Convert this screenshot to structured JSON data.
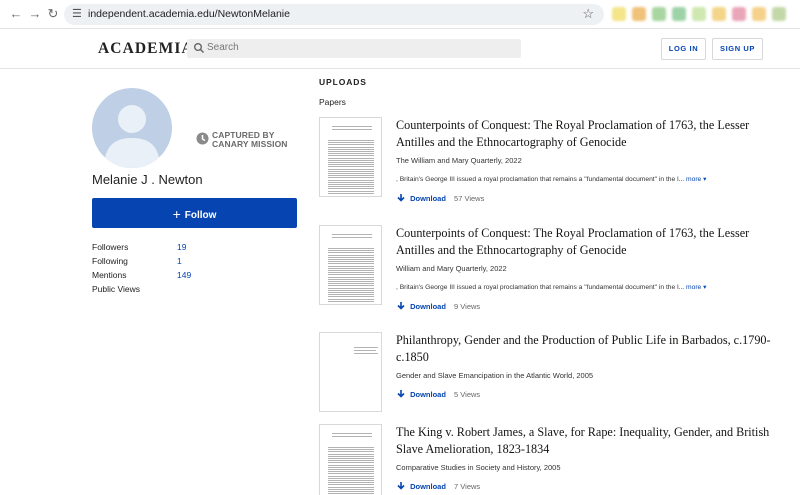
{
  "browser": {
    "url": "independent.academia.edu/NewtonMelanie",
    "colors": {
      "extensions": [
        "#f4e58a",
        "#f0c27a",
        "#a8d5a0",
        "#9ed3a8",
        "#cfe7b0",
        "#f3d68a",
        "#e9a6b8",
        "#f5d28c",
        "#c3d8a8"
      ]
    }
  },
  "header": {
    "logo": "ACADEMIA",
    "search_placeholder": "Search",
    "login_label": "LOG IN",
    "signup_label": "SIGN UP"
  },
  "profile": {
    "watermark_line1": "CAPTURED BY",
    "watermark_line2": "CANARY MISSION",
    "name": "Melanie J . Newton",
    "follow_label": "Follow",
    "stats": [
      {
        "label": "Followers",
        "value": "19"
      },
      {
        "label": "Following",
        "value": "1"
      },
      {
        "label": "Mentions",
        "value": "149"
      },
      {
        "label": "Public Views",
        "value": ""
      }
    ]
  },
  "uploads": {
    "title": "UPLOADS",
    "section_label": "Papers",
    "download_label": "Download",
    "more_label": "more",
    "papers": [
      {
        "title": "Counterpoints of Conquest: The Royal Proclamation of 1763, the Lesser Antilles and the Ethnocartography of Genocide",
        "venue": "The William and Mary Quarterly, 2022",
        "abstract": ", Britain's George III issued a royal proclamation that remains a \"fundamental document\" in the l...",
        "views": "57 Views"
      },
      {
        "title": "Counterpoints of Conquest: The Royal Proclamation of 1763, the Lesser Antilles and the Ethnocartography of Genocide",
        "venue": "William and Mary Quarterly, 2022",
        "abstract": ", Britain's George III issued a royal proclamation that remains a \"fundamental document\" in the l...",
        "views": "9 Views"
      },
      {
        "title": "Philanthropy, Gender and the Production of Public Life in Barbados, c.1790-c.1850",
        "venue": "Gender and Slave Emancipation in the Atlantic World, 2005",
        "abstract": "",
        "views": "5 Views"
      },
      {
        "title": "The King v. Robert James, a Slave, for Rape: Inequality, Gender, and British Slave Amelioration, 1823-1834",
        "venue": "Comparative Studies in Society and History, 2005",
        "abstract": "",
        "views": "7 Views"
      }
    ]
  }
}
